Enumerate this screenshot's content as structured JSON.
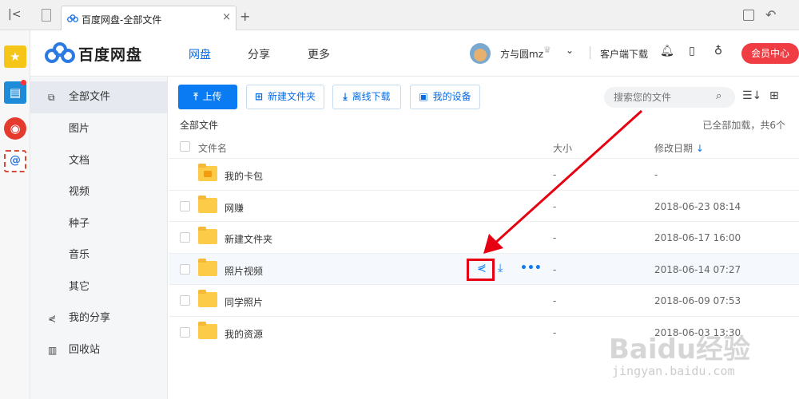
{
  "browser": {
    "tab_title": "百度网盘-全部文件",
    "new_tab_symbol": "+",
    "close_symbol": "×"
  },
  "header": {
    "brand": "百度网盘",
    "nav": [
      "网盘",
      "分享",
      "更多"
    ],
    "username": "方与圆mz",
    "client_download": "客户端下载",
    "member_center": "会员中心"
  },
  "sidebar": {
    "items": [
      {
        "icon": "document-icon",
        "label": "全部文件",
        "active": true
      },
      {
        "icon": "",
        "label": "图片"
      },
      {
        "icon": "",
        "label": "文档"
      },
      {
        "icon": "",
        "label": "视频"
      },
      {
        "icon": "",
        "label": "种子"
      },
      {
        "icon": "",
        "label": "音乐"
      },
      {
        "icon": "",
        "label": "其它"
      },
      {
        "icon": "share-icon",
        "label": "我的分享"
      },
      {
        "icon": "trash-icon",
        "label": "回收站"
      }
    ]
  },
  "toolbar": {
    "upload": "上传",
    "new_folder": "新建文件夹",
    "offline_download": "离线下载",
    "my_devices": "我的设备",
    "search_placeholder": "搜索您的文件"
  },
  "listing": {
    "breadcrumb": "全部文件",
    "loaded_text": "已全部加载，共6个",
    "col_name": "文件名",
    "col_size": "大小",
    "col_date": "修改日期",
    "rows": [
      {
        "name": "我的卡包",
        "size": "-",
        "date": "-"
      },
      {
        "name": "网赚",
        "size": "-",
        "date": "2018-06-23 08:14"
      },
      {
        "name": "新建文件夹",
        "size": "-",
        "date": "2018-06-17 16:00"
      },
      {
        "name": "照片视频",
        "size": "-",
        "date": "2018-06-14 07:27"
      },
      {
        "name": "同学照片",
        "size": "-",
        "date": "2018-06-09 07:53"
      },
      {
        "name": "我的资源",
        "size": "-",
        "date": "2018-06-03 13:30"
      }
    ]
  },
  "colors": {
    "accent": "#0a7bf2",
    "member_red": "#ef3d43",
    "annotation_red": "#e60012",
    "folder_yellow": "#fccb47"
  },
  "watermark": {
    "text": "Baidu经验",
    "url": "jingyan.baidu.com"
  }
}
